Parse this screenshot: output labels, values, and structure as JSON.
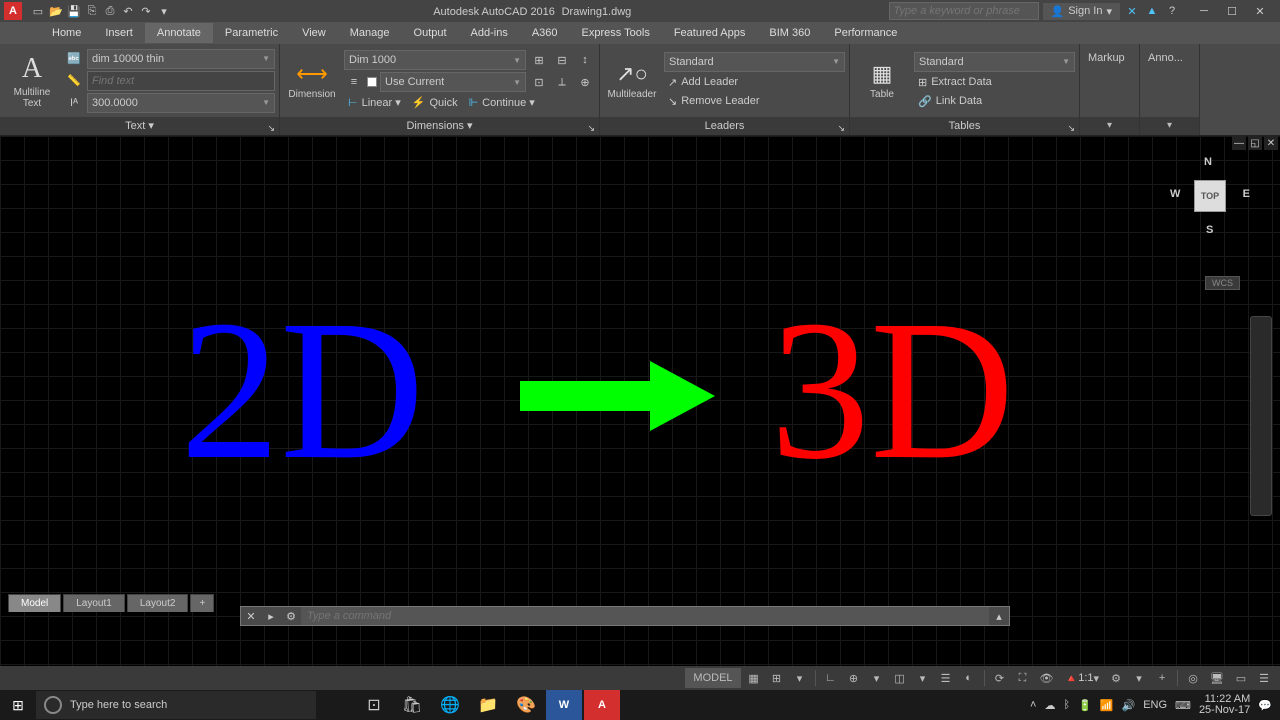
{
  "title": {
    "app": "Autodesk AutoCAD 2016",
    "file": "Drawing1.dwg"
  },
  "search_placeholder": "Type a keyword or phrase",
  "signin": "Sign In",
  "menus": [
    "Home",
    "Insert",
    "Annotate",
    "Parametric",
    "View",
    "Manage",
    "Output",
    "Add-ins",
    "A360",
    "Express Tools",
    "Featured Apps",
    "BIM 360",
    "Performance"
  ],
  "active_menu": "Annotate",
  "ribbon": {
    "text": {
      "big": "Multiline\nText",
      "style": "dim 10000 thin",
      "find_ph": "Find text",
      "height": "300.0000",
      "title": "Text ▾"
    },
    "dim": {
      "big": "Dimension",
      "style": "Dim 1000",
      "use_current": "Use Current",
      "linear": "Linear ▾",
      "quick": "Quick",
      "continue": "Continue ▾",
      "title": "Dimensions ▾"
    },
    "lead": {
      "big": "Multileader",
      "style": "Standard",
      "add": "Add Leader",
      "remove": "Remove Leader",
      "title": "Leaders"
    },
    "table": {
      "big": "Table",
      "style": "Standard",
      "extract": "Extract Data",
      "link": "Link Data",
      "title": "Tables"
    },
    "markup": "Markup",
    "anno": "Anno..."
  },
  "canvas": {
    "text2d": "2D",
    "text3d": "3D",
    "viewcube": {
      "top": "TOP",
      "n": "N",
      "s": "S",
      "e": "E",
      "w": "W"
    },
    "wcs": "WCS"
  },
  "cmd_placeholder": "Type a command",
  "bottom_tabs": [
    "Model",
    "Layout1",
    "Layout2"
  ],
  "status": {
    "model": "MODEL",
    "scale": "1:1",
    "lang": "ENG"
  },
  "taskbar": {
    "search": "Type here to search",
    "time": "11:22 AM",
    "date": "25-Nov-17"
  }
}
